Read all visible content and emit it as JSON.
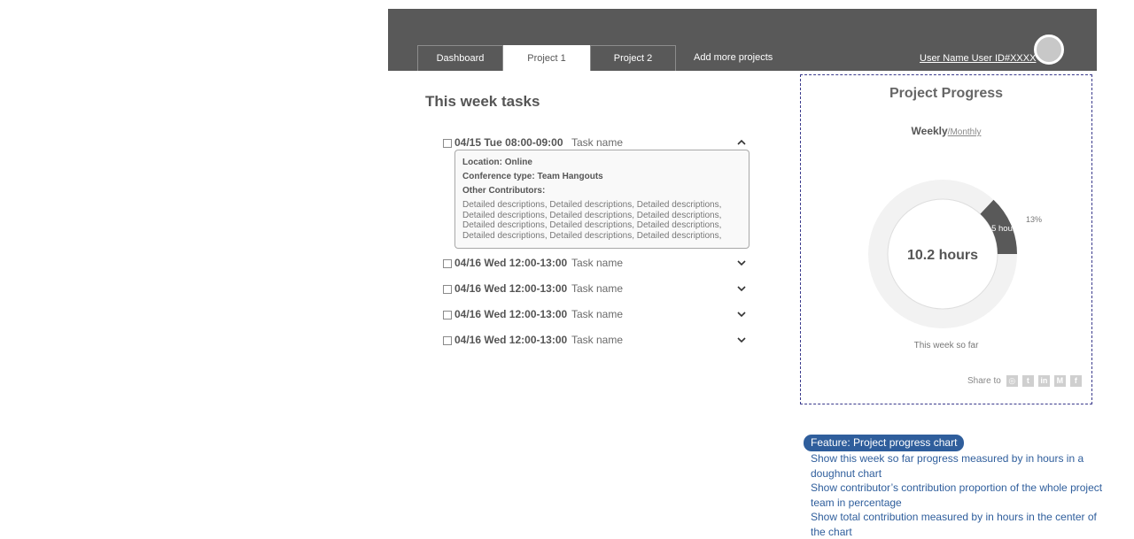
{
  "header": {
    "tabs": [
      "Dashboard",
      "Project 1",
      "Project 2",
      "Add more projects"
    ],
    "active_tab": "Project 1",
    "user": "User Name User ID#XXXX"
  },
  "tasks": {
    "title": "This week tasks",
    "items": [
      {
        "date": "04/15 Tue 08:00-09:00",
        "name": "Task name",
        "expanded": true
      },
      {
        "date": "04/16 Wed 12:00-13:00",
        "name": "Task name",
        "expanded": false
      },
      {
        "date": "04/16 Wed 12:00-13:00",
        "name": "Task name",
        "expanded": false
      },
      {
        "date": "04/16 Wed 12:00-13:00",
        "name": "Task name",
        "expanded": false
      },
      {
        "date": "04/16 Wed 12:00-13:00",
        "name": "Task name",
        "expanded": false
      }
    ],
    "details": {
      "location": "Location: Online",
      "conference": "Conference type: Team Hangouts",
      "contributors": "Other Contributors:",
      "description_lines": [
        "Detailed descriptions, Detailed descriptions, Detailed descriptions,",
        "Detailed descriptions, Detailed descriptions, Detailed descriptions,",
        "Detailed descriptions, Detailed descriptions, Detailed descriptions,",
        "Detailed descriptions, Detailed descriptions, Detailed descriptions,"
      ]
    }
  },
  "progress": {
    "title": "Project Progress",
    "period_weekly": "Weekly",
    "period_monthly": "/Monthly",
    "caption": "This week so far",
    "share_label": "Share to",
    "share_icons": [
      "instagram-icon",
      "twitter-icon",
      "linkedin-icon",
      "medium-icon",
      "facebook-icon"
    ]
  },
  "chart_data": {
    "type": "pie",
    "center_label": "10.2 hours",
    "total_hours": 10.2,
    "slices": [
      {
        "label": "1.5 hours",
        "hours": 1.5,
        "percent_label": "13%",
        "percent": 13,
        "color": "#595959"
      }
    ],
    "track_color": "#f2f2f2"
  },
  "note": {
    "badge": "Feature: Project progress chart",
    "lines": [
      "Show this week so far  progress measured by in hours in a doughnut chart",
      "Show contributor’s contribution proportion of the whole project team in percentage",
      "Show total contribution measured by in hours in the center of the chart"
    ]
  }
}
